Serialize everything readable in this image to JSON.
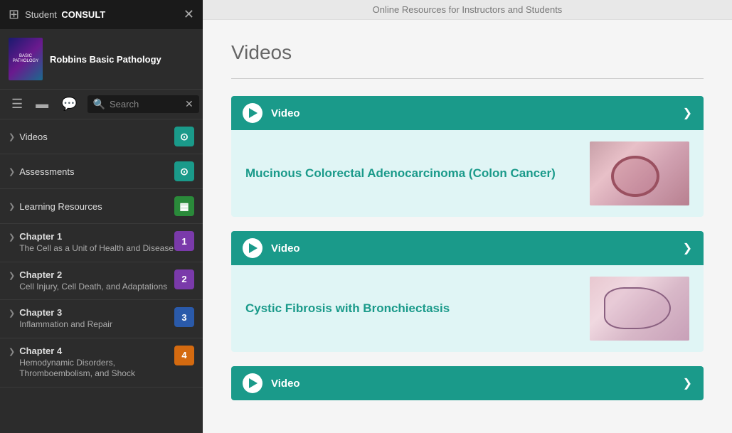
{
  "app": {
    "brand": "Student",
    "brand_consult": "CONSULT",
    "top_bar_text": "Online Resources for Instructors and Students"
  },
  "sidebar": {
    "book_title": "Robbins Basic Pathology",
    "book_cover_text": "BASIC\nPATHOLOGY",
    "search_placeholder": "Search",
    "nav_items": [
      {
        "label": "Videos",
        "badge_text": "",
        "badge_class": "badge-teal",
        "has_badge_icon": true
      },
      {
        "label": "Assessments",
        "badge_text": "",
        "badge_class": "badge-teal",
        "has_badge_icon": true
      },
      {
        "label": "Learning Resources",
        "badge_text": "",
        "badge_class": "badge-green",
        "has_badge_icon": true
      }
    ],
    "chapters": [
      {
        "title": "Chapter 1",
        "subtitle": "The Cell as a Unit of Health and Disease",
        "badge_text": "1",
        "badge_class": "badge-purple"
      },
      {
        "title": "Chapter 2",
        "subtitle": "Cell Injury, Cell Death, and Adaptations",
        "badge_text": "2",
        "badge_class": "badge-purple"
      },
      {
        "title": "Chapter 3",
        "subtitle": "Inflammation and Repair",
        "badge_text": "3",
        "badge_class": "badge-blue"
      },
      {
        "title": "Chapter 4",
        "subtitle": "Hemodynamic Disorders, Thromboembolism, and Shock",
        "badge_text": "4",
        "badge_class": "badge-orange"
      }
    ]
  },
  "main": {
    "page_title": "Videos",
    "videos": [
      {
        "header_label": "Video",
        "title": "Mucinous Colorectal Adenocarcinoma (Colon Cancer)",
        "thumb_type": "colon"
      },
      {
        "header_label": "Video",
        "title": "Cystic Fibrosis with Bronchiectasis",
        "thumb_type": "lung"
      },
      {
        "header_label": "Video",
        "title": "",
        "thumb_type": "none"
      }
    ]
  },
  "icons": {
    "grid": "⊞",
    "close": "✕",
    "search": "🔍",
    "list": "≡",
    "book": "📖",
    "comment": "💬",
    "chevron_right": "❯",
    "chevron_down": "❯",
    "play": "▶"
  }
}
